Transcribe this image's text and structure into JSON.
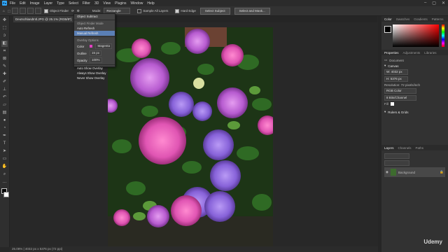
{
  "menubar": {
    "items": [
      "File",
      "Edit",
      "Image",
      "Layer",
      "Type",
      "Select",
      "Filter",
      "3D",
      "View",
      "Plugins",
      "Window",
      "Help"
    ]
  },
  "optionsbar": {
    "object_finder_label": "Object Finder",
    "mode_label": "Mode:",
    "mode_value": "Rectangle",
    "sample_all_layers": "Sample All Layers",
    "hard_edge": "Hard Edge",
    "select_subject": "Select Subject",
    "select_and_mask": "Select and Mask..."
  },
  "document": {
    "tab_title": "DeutschlandIntl.JPG @ 25.1% (RGB/8*)",
    "status": "25.08% | 4032 px x 5376 px (72 ppi)"
  },
  "dropdown": {
    "items": [
      {
        "label": "Object Subtract",
        "type": "item"
      },
      {
        "label": "Object Finder Mode",
        "type": "header"
      },
      {
        "label": "Auto Refresh",
        "type": "item"
      },
      {
        "label": "Manual Refresh",
        "type": "item",
        "selected": true
      },
      {
        "label": "Overlay Options",
        "type": "header"
      },
      {
        "label": "Color",
        "type": "field",
        "value": "Magenta"
      },
      {
        "label": "Outline",
        "type": "field",
        "value": "15 px"
      },
      {
        "label": "Opacity",
        "type": "field",
        "value": "100%"
      },
      {
        "label": "Auto Show Overlay",
        "type": "item"
      },
      {
        "label": "Always Show Overlay",
        "type": "item"
      },
      {
        "label": "Never Show Overlay",
        "type": "item"
      }
    ]
  },
  "panels": {
    "color_tabs": [
      "Color",
      "Swatches",
      "Gradients",
      "Patterns"
    ],
    "properties_tabs": [
      "Properties",
      "Adjustments",
      "Libraries"
    ],
    "document_label": "Document",
    "canvas_label": "Canvas",
    "width": "W: 4032 px",
    "height": "H: 5376 px",
    "resolution": "Resolution: 72 pixels/inch",
    "mode": "RGB Color",
    "bits": "8 Bits/Channel",
    "fill": "Fill",
    "rulers_grids": "Rulers & Grids",
    "layers_tabs": [
      "Layers",
      "Channels",
      "Paths"
    ],
    "layer_name": "Background",
    "color_hex": "#ff0000"
  },
  "watermark": "Udemy"
}
